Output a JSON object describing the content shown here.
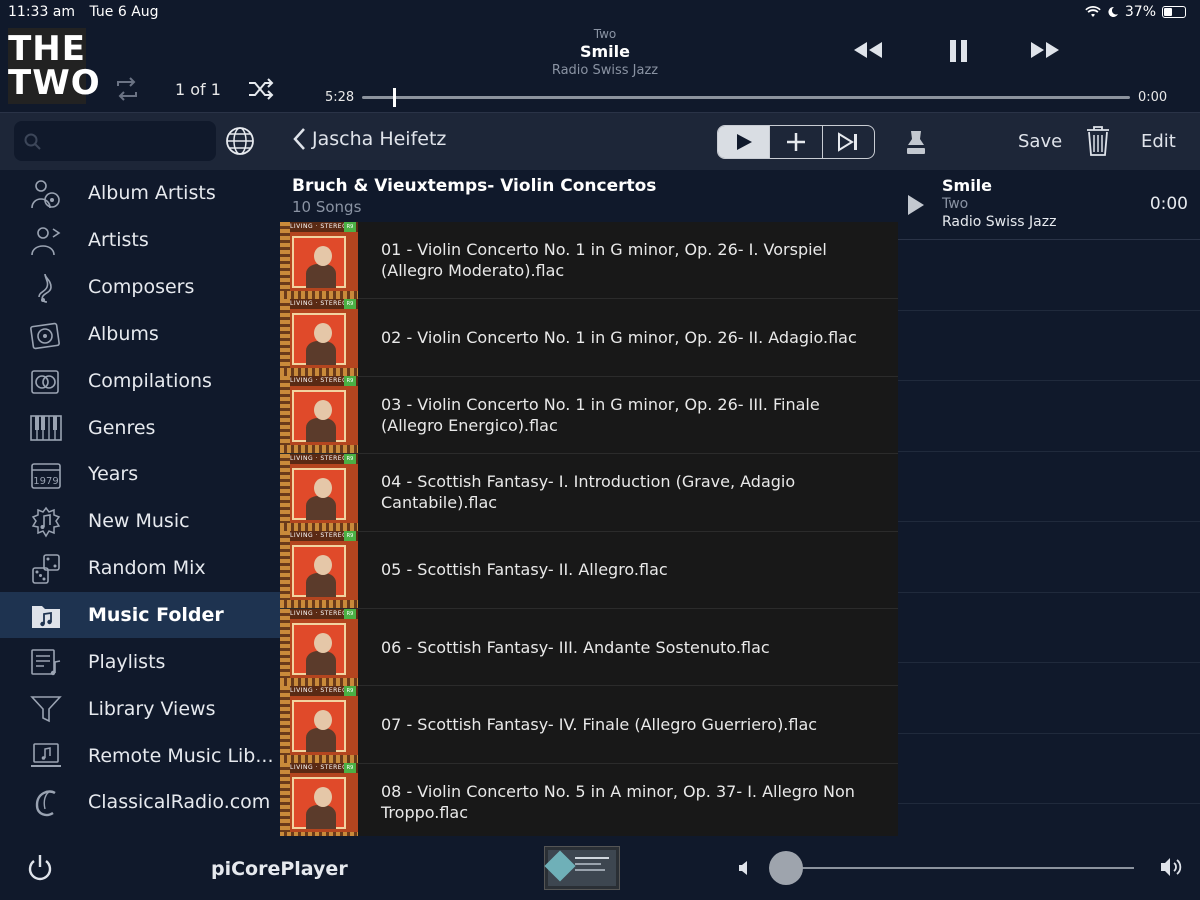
{
  "status": {
    "time": "11:33 am",
    "date": "Tue 6 Aug",
    "battery": "37%",
    "battery_level": 0.37
  },
  "header": {
    "logo_line1": "THE",
    "logo_line2": "TWO",
    "counter": "1 of 1",
    "np_album": "Two",
    "np_title": "Smile",
    "np_station": "Radio Swiss Jazz",
    "time_elapsed": "5:28",
    "time_remaining": "0:00",
    "progress": 0.04
  },
  "toolbar": {
    "search_placeholder": "",
    "back_label": "Jascha Heifetz",
    "save_label": "Save",
    "edit_label": "Edit"
  },
  "sidebar": {
    "items": [
      {
        "label": "Album Artists",
        "icon": "album-artists-icon"
      },
      {
        "label": "Artists",
        "icon": "artists-icon"
      },
      {
        "label": "Composers",
        "icon": "composers-icon"
      },
      {
        "label": "Albums",
        "icon": "albums-icon"
      },
      {
        "label": "Compilations",
        "icon": "compilations-icon"
      },
      {
        "label": "Genres",
        "icon": "genres-icon"
      },
      {
        "label": "Years",
        "icon": "years-icon"
      },
      {
        "label": "New Music",
        "icon": "new-music-icon"
      },
      {
        "label": "Random Mix",
        "icon": "random-mix-icon"
      },
      {
        "label": "Music Folder",
        "icon": "music-folder-icon",
        "active": true
      },
      {
        "label": "Playlists",
        "icon": "playlists-icon"
      },
      {
        "label": "Library Views",
        "icon": "library-views-icon"
      },
      {
        "label": "Remote Music Lib...",
        "icon": "remote-library-icon"
      },
      {
        "label": "ClassicalRadio.com",
        "icon": "classical-radio-icon"
      }
    ]
  },
  "album": {
    "title": "Bruch & Vieuxtemps- Violin Concertos",
    "subtitle": "10 Songs",
    "thumb_labels": {
      "living": "LIVING · STEREO",
      "badge": "R9"
    },
    "tracks": [
      "01 - Violin Concerto No. 1 in G minor, Op. 26- I. Vorspiel (Allegro Moderato).flac",
      "02 - Violin Concerto No. 1 in G minor, Op. 26- II. Adagio.flac",
      "03 - Violin Concerto No. 1 in G minor, Op. 26- III. Finale (Allegro Energico).flac",
      "04 - Scottish Fantasy- I. Introduction (Grave, Adagio Cantabile).flac",
      "05 - Scottish Fantasy- II. Allegro.flac",
      "06 - Scottish Fantasy- III. Andante Sostenuto.flac",
      "07 - Scottish Fantasy- IV. Finale (Allegro Guerriero).flac",
      "08 - Violin Concerto No. 5 in A minor, Op. 37- I. Allegro Non Troppo.flac"
    ]
  },
  "queue": {
    "item": {
      "title": "Smile",
      "album": "Two",
      "station": "Radio Swiss Jazz",
      "time": "0:00"
    }
  },
  "footer": {
    "player_name": "piCorePlayer",
    "volume": 0.04
  }
}
